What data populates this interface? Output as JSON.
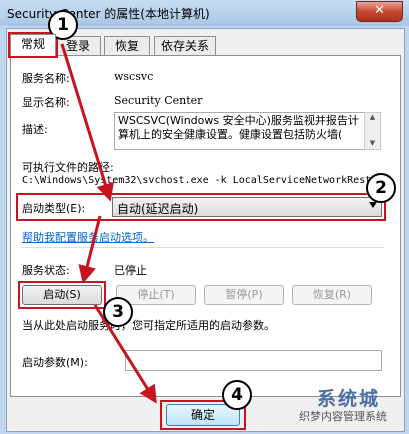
{
  "window": {
    "title": "Security Center 的属性(本地计算机)",
    "close_label": "✕"
  },
  "tabs": [
    {
      "label": "常规"
    },
    {
      "label": "登录"
    },
    {
      "label": "恢复"
    },
    {
      "label": "依存关系"
    }
  ],
  "general": {
    "service_name_label": "服务名称:",
    "service_name_value": "wscsvc",
    "display_name_label": "显示名称:",
    "display_name_value": "Security Center",
    "description_label": "描述:",
    "description_value": "WSCSVC(Windows 安全中心)服务监视并报告计算机上的安全健康设置。健康设置包括防火墙(",
    "exe_path_label": "可执行文件的路径:",
    "exe_path_value": "C:\\Windows\\System32\\svchost.exe -k LocalServiceNetworkRest",
    "startup_type_label": "启动类型(E):",
    "startup_type_value": "自动(延迟启动)",
    "help_link": "帮助我配置服务启动选项。",
    "status_label": "服务状态:",
    "status_value": "已停止",
    "start_button": "启动(S)",
    "stop_button": "停止(T)",
    "pause_button": "暂停(P)",
    "resume_button": "恢复(R)",
    "hint_text": "当从此处启动服务时，您可指定所适用的启动参数。",
    "start_params_label": "启动参数(M):",
    "start_params_value": ""
  },
  "footer": {
    "ok_button": "确定"
  },
  "annotations": {
    "step1": "1",
    "step2": "2",
    "step3": "3",
    "step4": "4",
    "accent_color": "#c8141e"
  },
  "watermark": {
    "brand": "系统城",
    "caption": "织梦内容管理系统"
  }
}
